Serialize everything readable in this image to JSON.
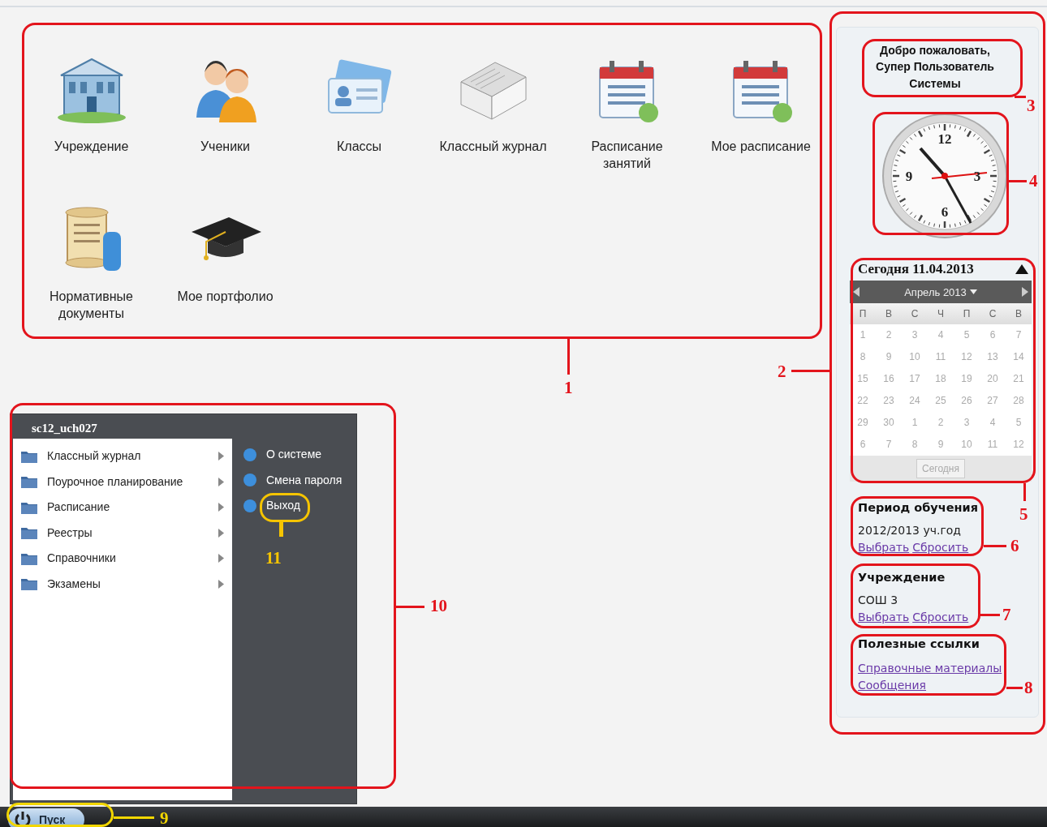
{
  "desktop_shortcuts": [
    {
      "label": "Учреждение"
    },
    {
      "label": "Ученики"
    },
    {
      "label": "Классы"
    },
    {
      "label": "Классный журнал"
    },
    {
      "label": "Расписание занятий"
    },
    {
      "label": "Мое расписание"
    },
    {
      "label": "Нормативные документы"
    },
    {
      "label": "Мое портфолио"
    }
  ],
  "sidebar": {
    "welcome": "Добро пожаловать, Супер Пользователь Системы",
    "clock": {
      "numerals": [
        "12",
        "3",
        "9",
        "6"
      ]
    },
    "calendar": {
      "today_label": "Сегодня 11.04.2013",
      "month": "Апрель 2013",
      "weekdays": [
        "П",
        "В",
        "С",
        "Ч",
        "П",
        "С",
        "В"
      ],
      "weeks": [
        [
          "1",
          "2",
          "3",
          "4",
          "5",
          "6",
          "7"
        ],
        [
          "8",
          "9",
          "10",
          "11",
          "12",
          "13",
          "14"
        ],
        [
          "15",
          "16",
          "17",
          "18",
          "19",
          "20",
          "21"
        ],
        [
          "22",
          "23",
          "24",
          "25",
          "26",
          "27",
          "28"
        ],
        [
          "29",
          "30",
          "1",
          "2",
          "3",
          "4",
          "5"
        ],
        [
          "6",
          "7",
          "8",
          "9",
          "10",
          "11",
          "12"
        ]
      ],
      "today_button": "Сегодня"
    },
    "study_period": {
      "title": "Период обучения",
      "value": "2012/2013 уч.год",
      "links": [
        "Выбрать",
        "Сбросить"
      ]
    },
    "institution": {
      "title": "Учреждение",
      "value": "СОШ 3",
      "links": [
        "Выбрать",
        "Сбросить"
      ]
    },
    "useful_links": {
      "title": "Полезные ссылки",
      "links": [
        "Справочные материалы",
        "Сообщения"
      ]
    }
  },
  "start_menu": {
    "user": "sc12_uch027",
    "items": [
      {
        "label": "Классный журнал"
      },
      {
        "label": "Поурочное планирование"
      },
      {
        "label": "Расписание"
      },
      {
        "label": "Реестры"
      },
      {
        "label": "Справочники"
      },
      {
        "label": "Экзамены"
      }
    ],
    "system_items": [
      {
        "label": "О системе"
      },
      {
        "label": "Смена пароля"
      },
      {
        "label": "Выход"
      }
    ]
  },
  "taskbar": {
    "start_button": "Пуск"
  },
  "annotations": [
    {
      "label": "1",
      "color": "#e3141c"
    },
    {
      "label": "2",
      "color": "#e3141c"
    },
    {
      "label": "3",
      "color": "#e3141c"
    },
    {
      "label": "4",
      "color": "#e3141c"
    },
    {
      "label": "5",
      "color": "#e3141c"
    },
    {
      "label": "6",
      "color": "#e3141c"
    },
    {
      "label": "7",
      "color": "#e3141c"
    },
    {
      "label": "8",
      "color": "#e3141c"
    },
    {
      "label": "9",
      "color": "#f2d600"
    },
    {
      "label": "10",
      "color": "#e3141c"
    },
    {
      "label": "11",
      "color": "#f5c400"
    }
  ]
}
